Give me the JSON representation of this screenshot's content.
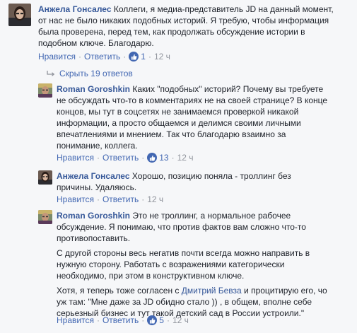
{
  "comments": [
    {
      "author": "Анжела Гонсалес",
      "text_lines": [
        " Коллеги, я медиа-представитель JD на данный момент,",
        "от нас не было никаких подобных историй. Я требую, чтобы информация",
        "была проверена, перед тем, как продолжать обсуждение истории в",
        "подобном ключе. Благодарю."
      ],
      "like_label": "Нравится",
      "reply_label": "Ответить",
      "likes": "1",
      "time": "12 ч"
    }
  ],
  "show_replies_label": "Скрыть 19 ответов",
  "replies": [
    {
      "author": "Roman Goroshkin",
      "text_lines": [
        " Каких \"подобных\" историй? Почему вы требуете",
        "не обсуждать что-то в комментариях не на своей странице? В конце",
        "концов, мы тут в соцсетях не занимаемся проверкой никакой",
        "информации, а просто общаемся и делимся своими личными",
        "впечатлениями и мнением. Так что благодарю взаимно за",
        "понимание, коллега."
      ],
      "like_label": "Нравится",
      "reply_label": "Ответить",
      "likes": "13",
      "time": "12 ч"
    },
    {
      "author": "Анжела Гонсалес",
      "text_lines": [
        " Хорошо, позицию поняла - троллинг без",
        "причины. Удаляюсь."
      ],
      "like_label": "Нравится",
      "reply_label": "Ответить",
      "time": "12 ч"
    },
    {
      "author": "Roman Goroshkin",
      "para1_lines": [
        " Это не троллинг, а нормальное рабочее",
        "обсуждение. Я понимаю, что против фактов вам сложно что-то",
        "противопоставить."
      ],
      "para2_lines": [
        "С другой стороны весь негатив почти всегда можно направить в",
        "нужную сторону. Работать с возражениями категорически",
        "необходимо, при этом в конструктивном ключе."
      ],
      "para3_before_mention": "Хотя, я теперь тоже согласен с ",
      "mention": "Дмитрий Бевза",
      "para3_after_mention": " и процитирую его, чо",
      "para3_lines": [
        "уж там: \"Мне даже за JD обидно стало )) , в общем, вполне себе",
        "серьезный бизнес и тут такой детский сад в России устроили.\""
      ],
      "like_label": "Нравится",
      "reply_label": "Ответить",
      "likes": "5",
      "time": "12 ч"
    }
  ]
}
